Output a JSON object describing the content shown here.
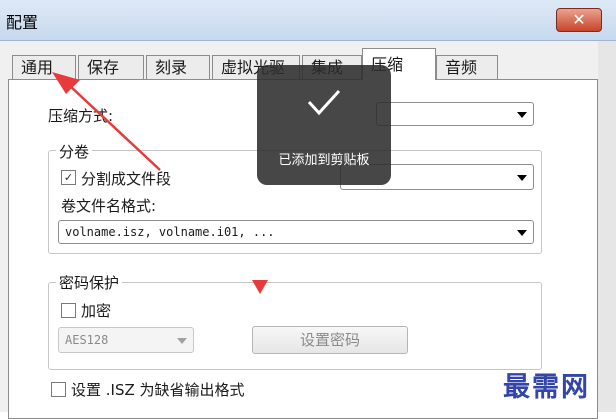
{
  "window": {
    "title": "配置",
    "close_label": "✕"
  },
  "tabs": [
    {
      "label": "通用"
    },
    {
      "label": "保存"
    },
    {
      "label": "刻录"
    },
    {
      "label": "虚拟光驱"
    },
    {
      "label": "集成"
    },
    {
      "label": "压缩"
    },
    {
      "label": "音频"
    }
  ],
  "active_tab": "压缩",
  "compression": {
    "method_label": "压缩方式:"
  },
  "split": {
    "group_label": "分卷",
    "checkbox_label": "分割成文件段",
    "checked": true,
    "filename_label": "卷文件名格式:",
    "filename_value": "volname.isz, volname.i01, ..."
  },
  "password": {
    "group_label": "密码保护",
    "encrypt_label": "加密",
    "encrypt_checked": false,
    "algorithm_value": "AES128",
    "set_password_label": "设置密码"
  },
  "default_format": {
    "label": "设置 .ISZ 为缺省输出格式",
    "checked": false
  },
  "toast": {
    "text": "已添加到剪贴板"
  },
  "watermark": {
    "text": "最需网"
  },
  "colors": {
    "annotation_red": "#e83a3a",
    "watermark_blue": "#3344aa",
    "toast_bg": "#2d2d2d"
  }
}
